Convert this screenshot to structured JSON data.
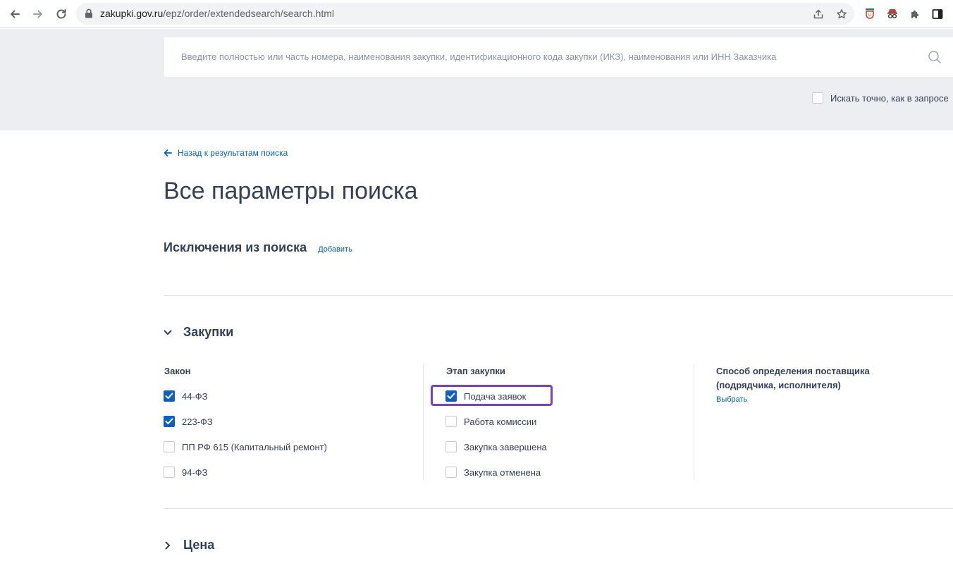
{
  "browser": {
    "url_host": "zakupki.gov.ru",
    "url_path": "/epz/order/extendedsearch/search.html"
  },
  "search": {
    "placeholder": "Введите полностью или часть номера, наименования закупки, идентификационного кода закупки (ИКЗ), наименования или ИНН Заказчика",
    "exact_label": "Искать точно, как в запросе",
    "exact_checked": false
  },
  "nav": {
    "back_label": "Назад к результатам поиска"
  },
  "page": {
    "title": "Все параметры поиска"
  },
  "exclusions": {
    "heading": "Исключения из поиска",
    "add_label": "Добавить"
  },
  "sections": {
    "purchases": {
      "title": "Закупки",
      "expanded": true,
      "law": {
        "heading": "Закон",
        "options": [
          {
            "label": "44-ФЗ",
            "checked": true
          },
          {
            "label": "223-ФЗ",
            "checked": true
          },
          {
            "label": "ПП РФ 615 (Капитальный ремонт)",
            "checked": false
          },
          {
            "label": "94-ФЗ",
            "checked": false
          }
        ]
      },
      "stage": {
        "heading": "Этап закупки",
        "options": [
          {
            "label": "Подача заявок",
            "checked": true
          },
          {
            "label": "Работа комиссии",
            "checked": false
          },
          {
            "label": "Закупка завершена",
            "checked": false
          },
          {
            "label": "Закупка отменена",
            "checked": false
          }
        ]
      },
      "method": {
        "heading": "Способ определения поставщика (подрядчика, исполнителя)",
        "choose_label": "Выбрать"
      }
    },
    "price": {
      "title": "Цена",
      "expanded": false
    }
  },
  "colors": {
    "accent": "#0065b1",
    "checkbox_on": "#0d5fc2",
    "highlight": "#7b3fd0",
    "text": "#334059"
  }
}
